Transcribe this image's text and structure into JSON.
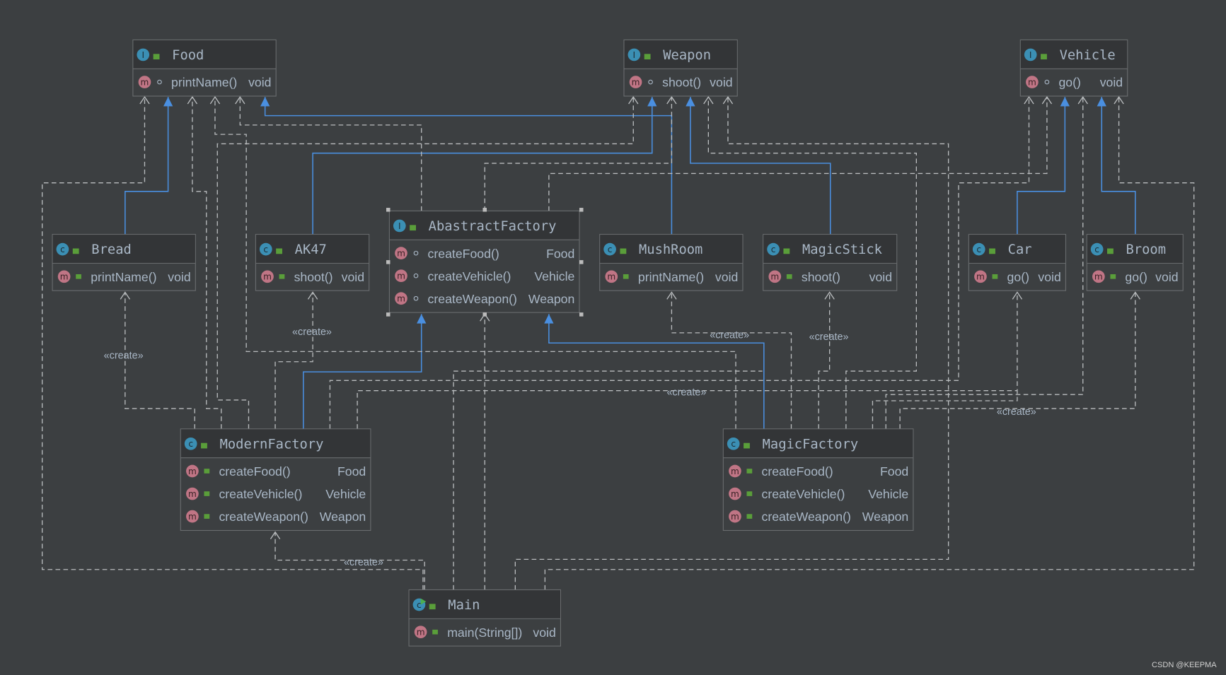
{
  "colors": {
    "background": "#3c3f41",
    "text": "#a9b7c6",
    "inheritance": "#4a8fe0",
    "dependency": "#b9bcbe",
    "class_icon": "#3b8fb4",
    "method_icon": "#c07585",
    "lock": "#5a9e3a"
  },
  "nodes": [
    {
      "id": "Food",
      "name": "Food",
      "kind": "interface",
      "members": [
        {
          "name": "printName()",
          "type": "void"
        }
      ]
    },
    {
      "id": "Weapon",
      "name": "Weapon",
      "kind": "interface",
      "members": [
        {
          "name": "shoot()",
          "type": "void"
        }
      ]
    },
    {
      "id": "Vehicle",
      "name": "Vehicle",
      "kind": "interface",
      "members": [
        {
          "name": "go()",
          "type": "void"
        }
      ]
    },
    {
      "id": "Bread",
      "name": "Bread",
      "kind": "class",
      "members": [
        {
          "name": "printName()",
          "type": "void"
        }
      ]
    },
    {
      "id": "AK47",
      "name": "AK47",
      "kind": "class",
      "members": [
        {
          "name": "shoot()",
          "type": "void"
        }
      ]
    },
    {
      "id": "AbastractFactory",
      "name": "AbastractFactory",
      "kind": "interface",
      "selected": true,
      "members": [
        {
          "name": "createFood()",
          "type": "Food"
        },
        {
          "name": "createVehicle()",
          "type": "Vehicle"
        },
        {
          "name": "createWeapon()",
          "type": "Weapon"
        }
      ]
    },
    {
      "id": "MushRoom",
      "name": "MushRoom",
      "kind": "class",
      "members": [
        {
          "name": "printName()",
          "type": "void"
        }
      ]
    },
    {
      "id": "MagicStick",
      "name": "MagicStick",
      "kind": "class",
      "members": [
        {
          "name": "shoot()",
          "type": "void"
        }
      ]
    },
    {
      "id": "Car",
      "name": "Car",
      "kind": "class",
      "members": [
        {
          "name": "go()",
          "type": "void"
        }
      ]
    },
    {
      "id": "Broom",
      "name": "Broom",
      "kind": "class",
      "members": [
        {
          "name": "go()",
          "type": "void"
        }
      ]
    },
    {
      "id": "ModernFactory",
      "name": "ModernFactory",
      "kind": "class",
      "members": [
        {
          "name": "createFood()",
          "type": "Food"
        },
        {
          "name": "createVehicle()",
          "type": "Vehicle"
        },
        {
          "name": "createWeapon()",
          "type": "Weapon"
        }
      ]
    },
    {
      "id": "MagicFactory",
      "name": "MagicFactory",
      "kind": "class",
      "members": [
        {
          "name": "createFood()",
          "type": "Food"
        },
        {
          "name": "createVehicle()",
          "type": "Vehicle"
        },
        {
          "name": "createWeapon()",
          "type": "Weapon"
        }
      ]
    },
    {
      "id": "Main",
      "name": "Main",
      "kind": "main",
      "members": [
        {
          "name": "main(String[])",
          "type": "void"
        }
      ]
    }
  ],
  "create_label": "«create»",
  "watermark": "CSDN @KEEPMA"
}
